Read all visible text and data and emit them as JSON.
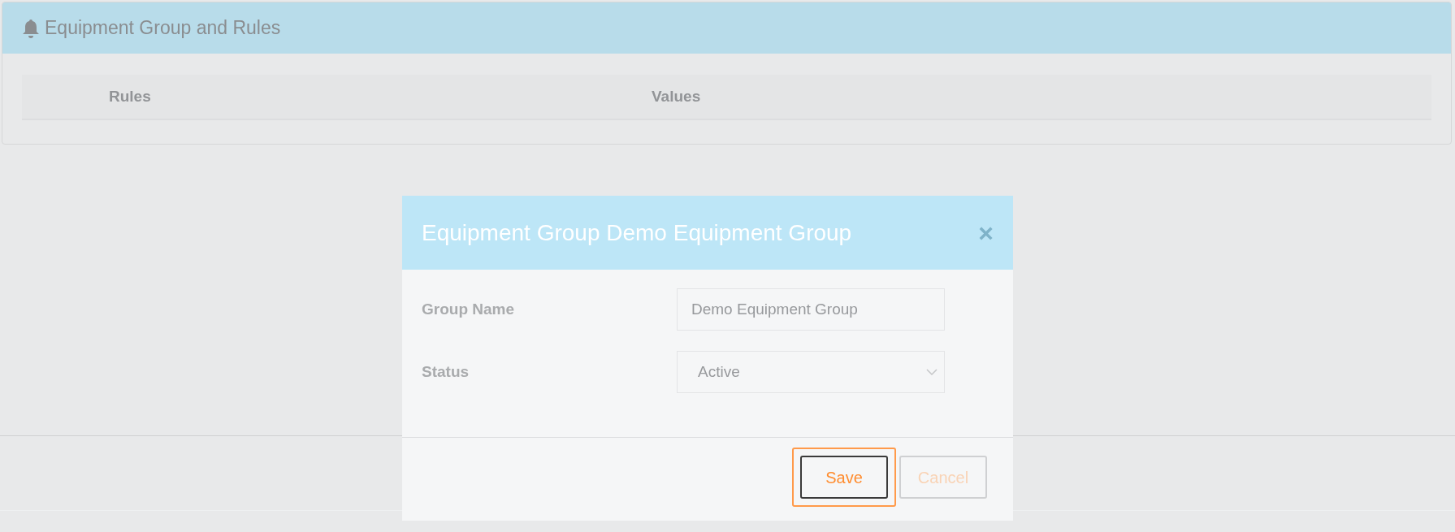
{
  "panel": {
    "title": "Equipment Group and Rules",
    "table": {
      "columns": [
        "Rules",
        "Values"
      ]
    }
  },
  "modal": {
    "title": "Equipment Group Demo Equipment Group",
    "close": "×",
    "fields": [
      {
        "kind": "text",
        "label": "Group Name",
        "value": "Demo Equipment Group"
      },
      {
        "kind": "select",
        "label": "Status",
        "value": "Active"
      }
    ],
    "buttons": [
      {
        "label": "Save",
        "focused": true
      },
      {
        "label": "Cancel",
        "focused": false
      }
    ]
  }
}
